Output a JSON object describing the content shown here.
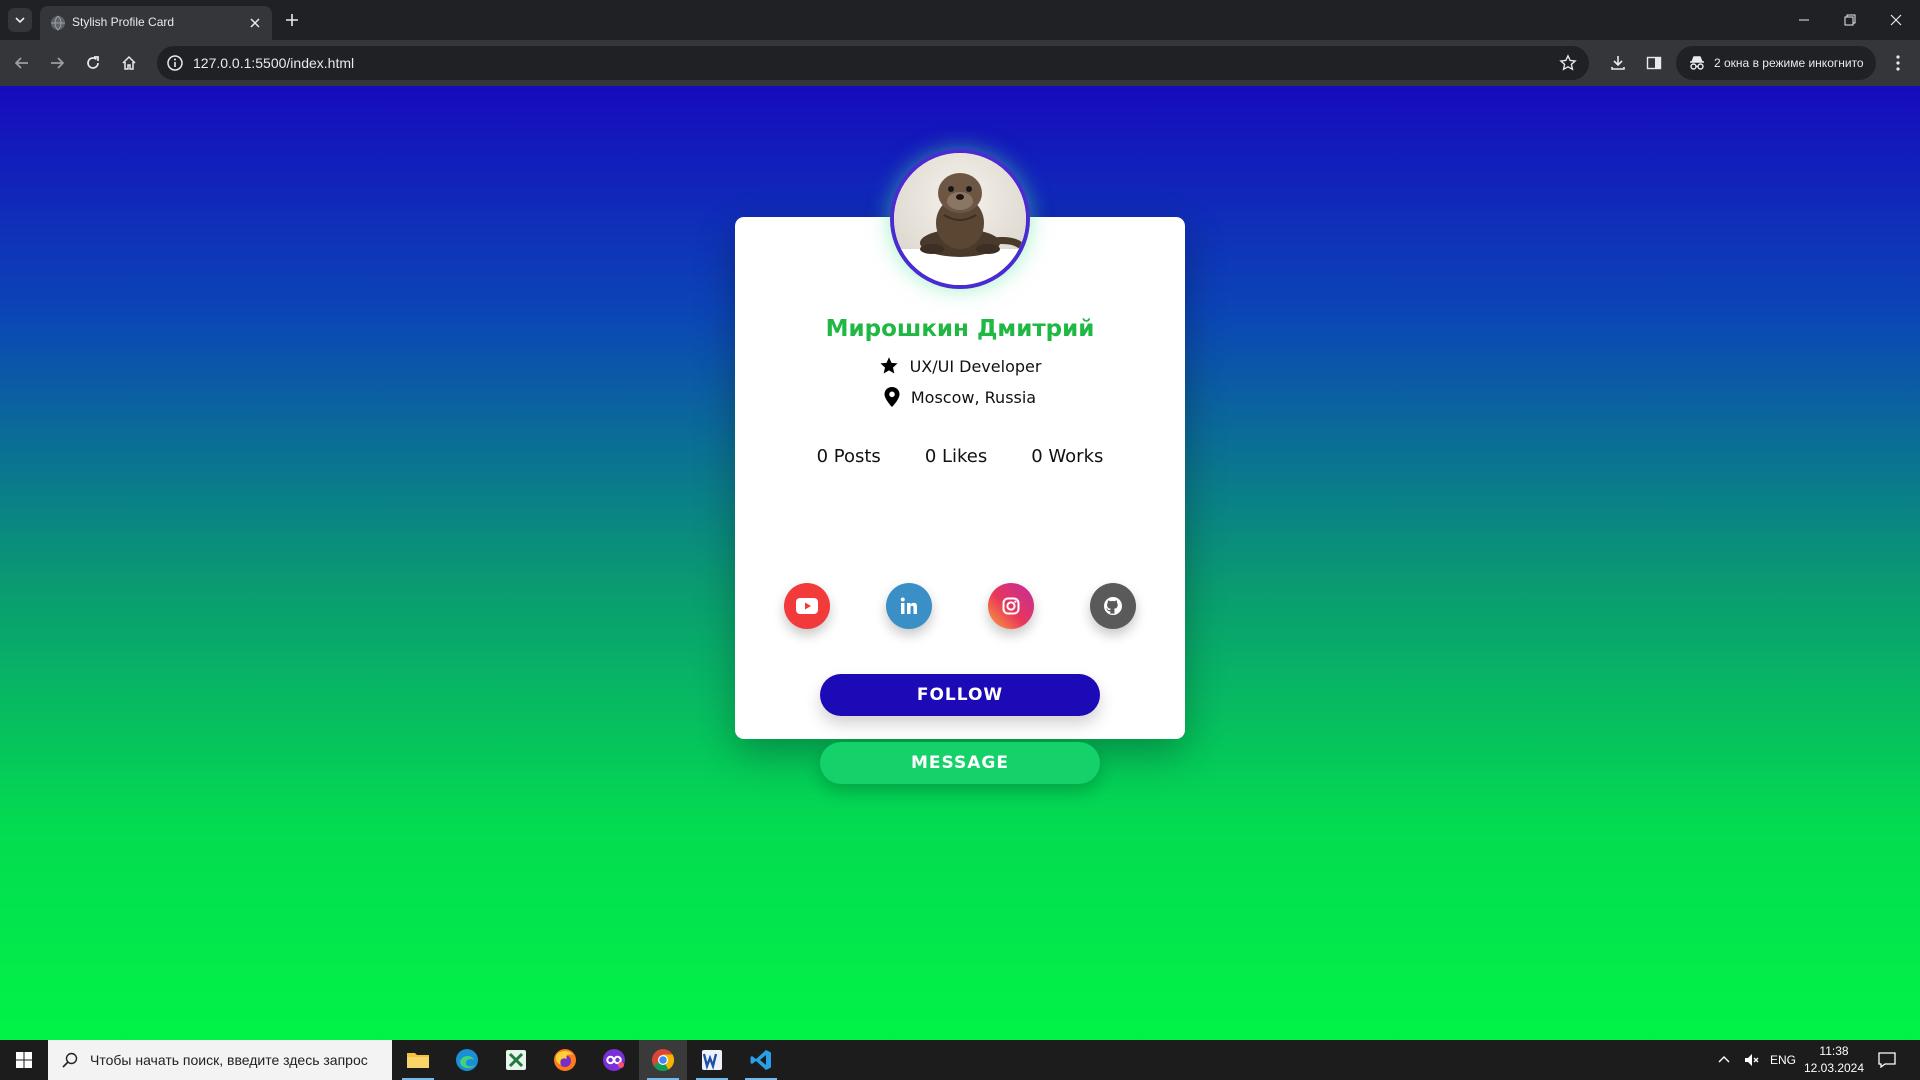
{
  "browser": {
    "tab_title": "Stylish Profile Card",
    "url": "127.0.0.1:5500/index.html",
    "incognito_label": "2 окна в режиме инкогнито"
  },
  "profile": {
    "name": "Мирошкин Дмитрий",
    "role": "UX/UI Developer",
    "location": "Moscow, Russia",
    "stats": {
      "posts": "0 Posts",
      "likes": "0 Likes",
      "works": "0 Works"
    },
    "social": [
      "youtube",
      "linkedin",
      "instagram",
      "github"
    ],
    "buttons": {
      "follow": "FOLLOW",
      "message": "MESSAGE"
    }
  },
  "taskbar": {
    "search_placeholder": "Чтобы начать поиск, введите здесь запрос",
    "language": "ENG",
    "time": "11:38",
    "date": "12.03.2024"
  },
  "colors": {
    "gradient_top": "#160bbd",
    "gradient_bottom": "#01f347",
    "name_green": "#1fb843",
    "follow_blue": "#1b0ab6",
    "message_green": "#14d16a",
    "avatar_ring": "#4a2bd2"
  }
}
